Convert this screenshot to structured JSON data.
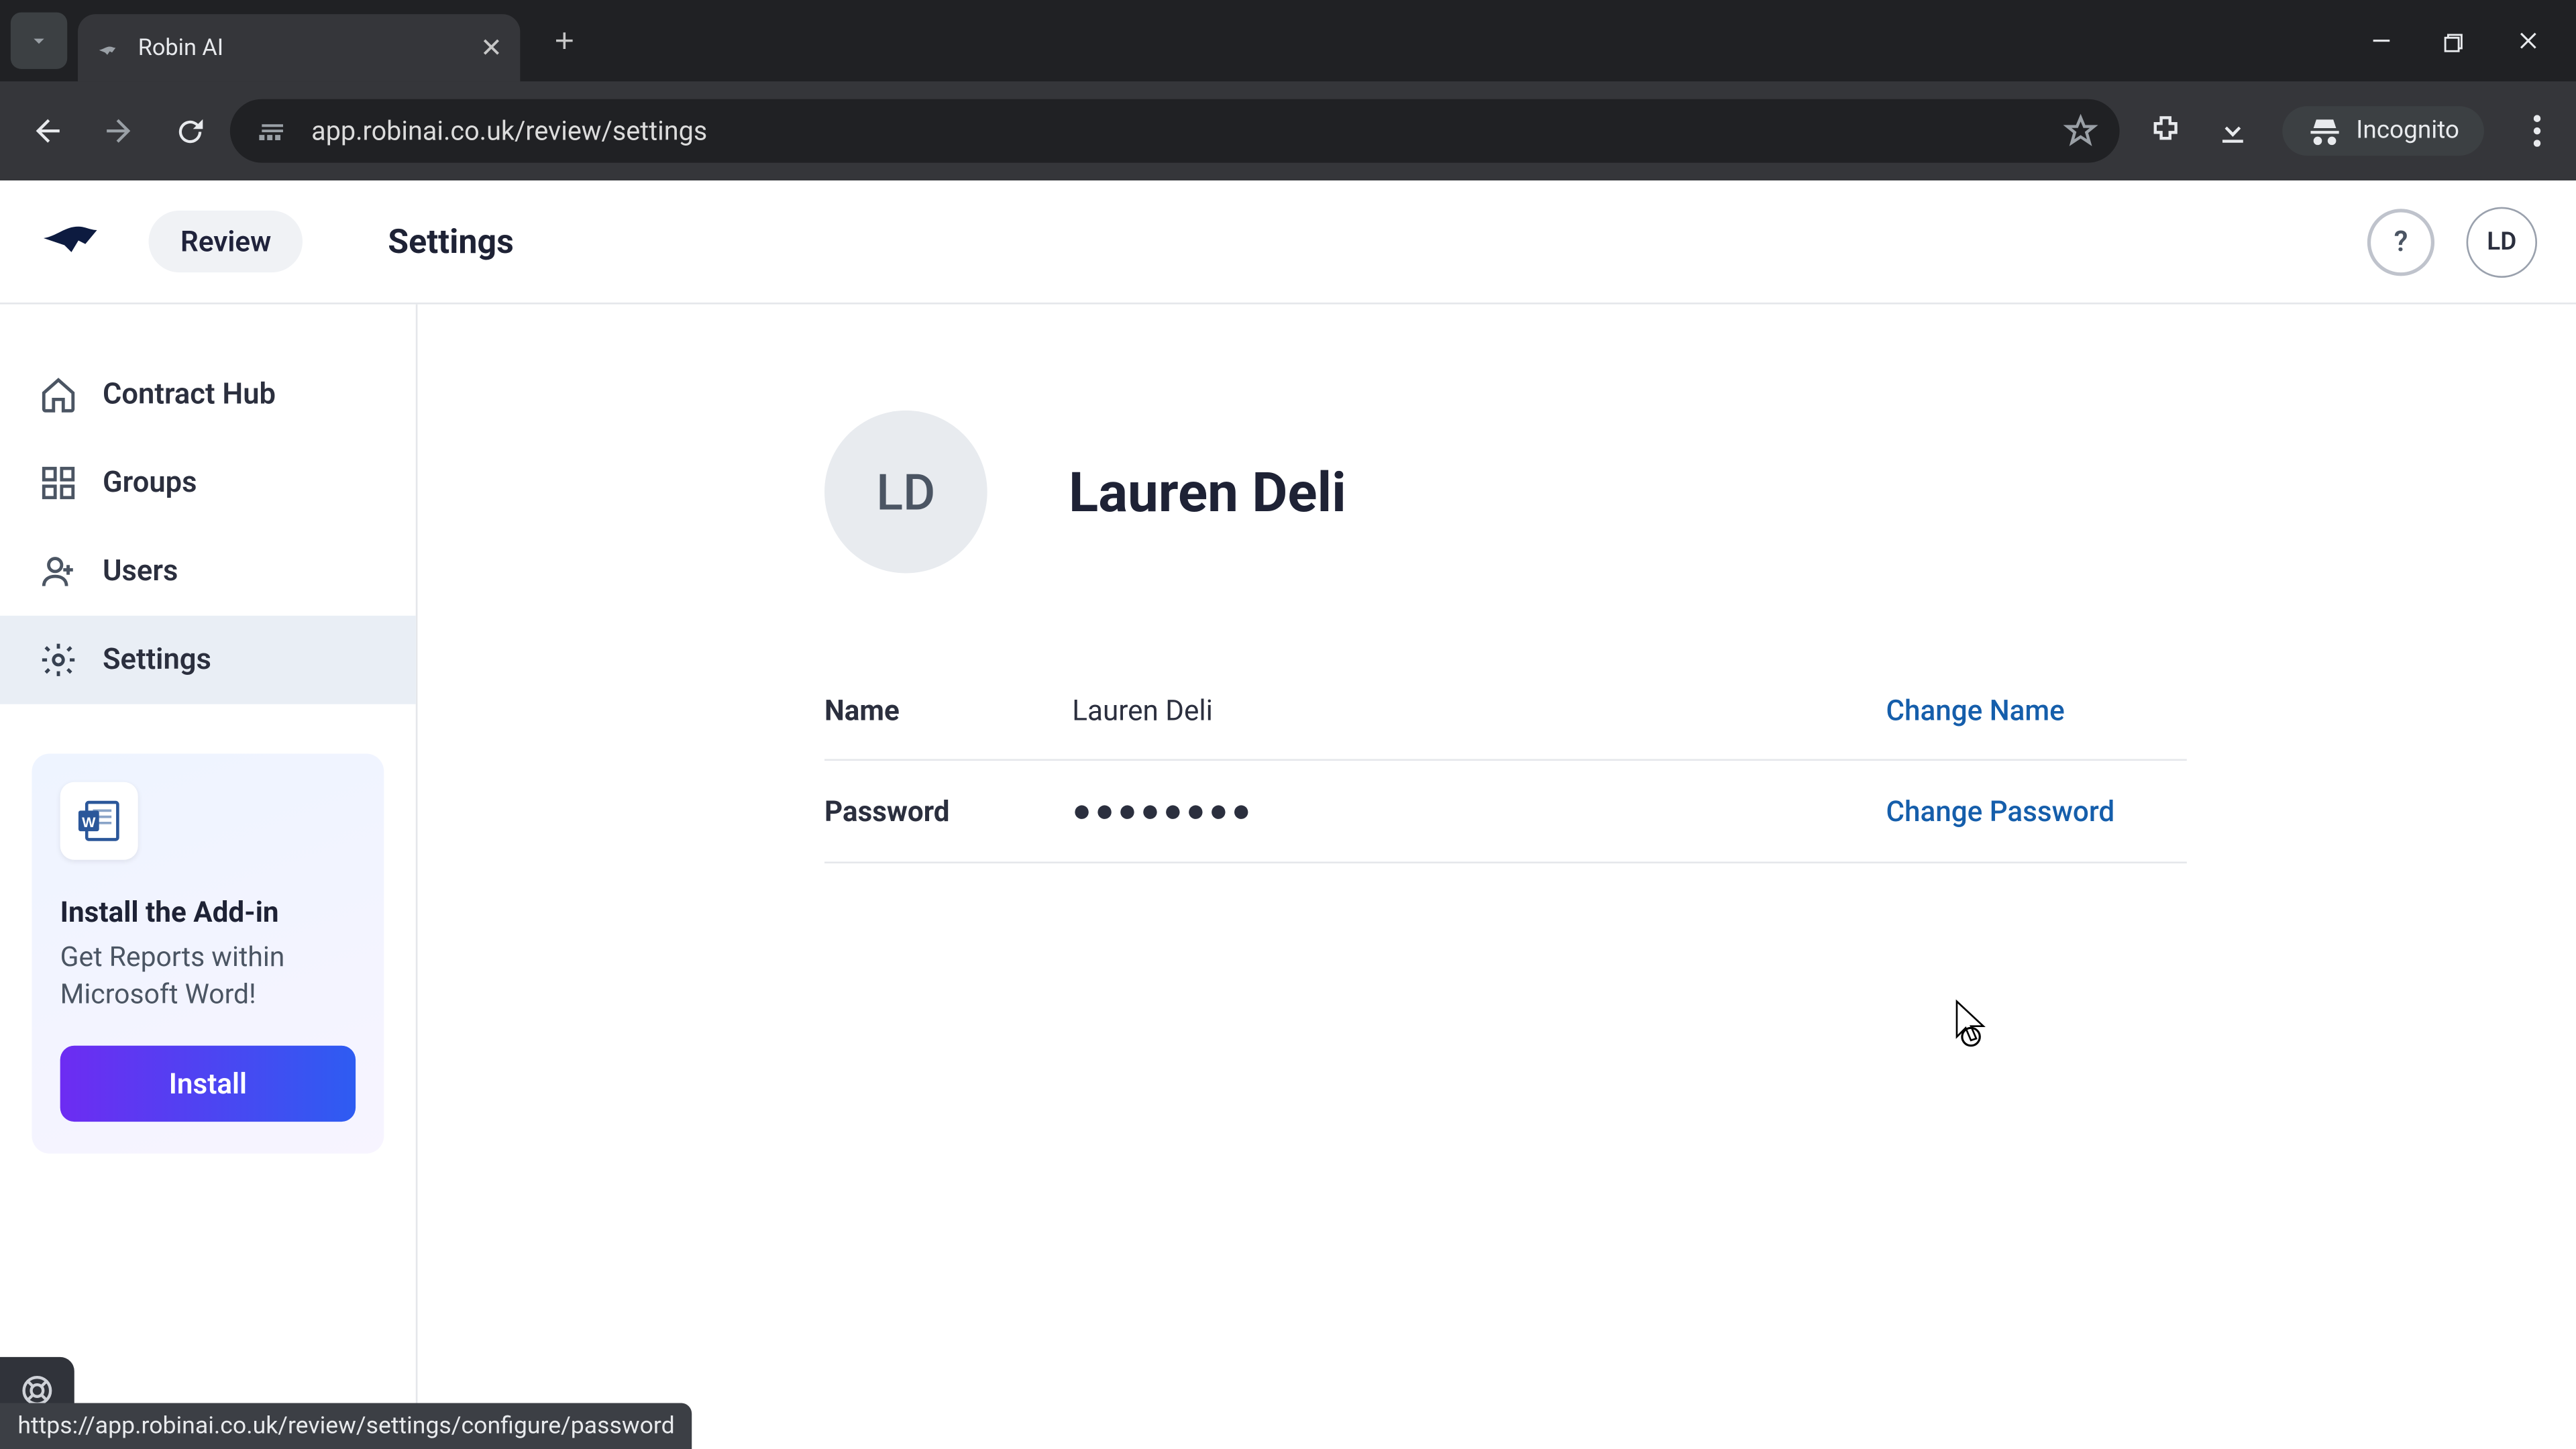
{
  "browser": {
    "tab_title": "Robin AI",
    "url": "app.robinai.co.uk/review/settings",
    "incognito_label": "Incognito"
  },
  "header": {
    "review_label": "Review",
    "page_title": "Settings",
    "avatar_initials": "LD"
  },
  "sidebar": {
    "items": [
      {
        "label": "Contract Hub",
        "active": false
      },
      {
        "label": "Groups",
        "active": false
      },
      {
        "label": "Users",
        "active": false
      },
      {
        "label": "Settings",
        "active": true
      }
    ],
    "promo": {
      "title": "Install the Add-in",
      "subtitle": "Get Reports within Microsoft Word!",
      "button": "Install"
    }
  },
  "profile": {
    "avatar_initials": "LD",
    "display_name": "Lauren Deli",
    "fields": {
      "name": {
        "label": "Name",
        "value": "Lauren Deli",
        "action": "Change Name"
      },
      "password": {
        "label": "Password",
        "value": "●●●●●●●●",
        "action": "Change Password"
      }
    }
  },
  "status_bar": "https://app.robinai.co.uk/review/settings/configure/password",
  "colors": {
    "link": "#155eab",
    "sidebar_active_bg": "#e9eef5",
    "promo_gradient_start": "#6d2cf2",
    "promo_gradient_end": "#2e5cf2"
  }
}
